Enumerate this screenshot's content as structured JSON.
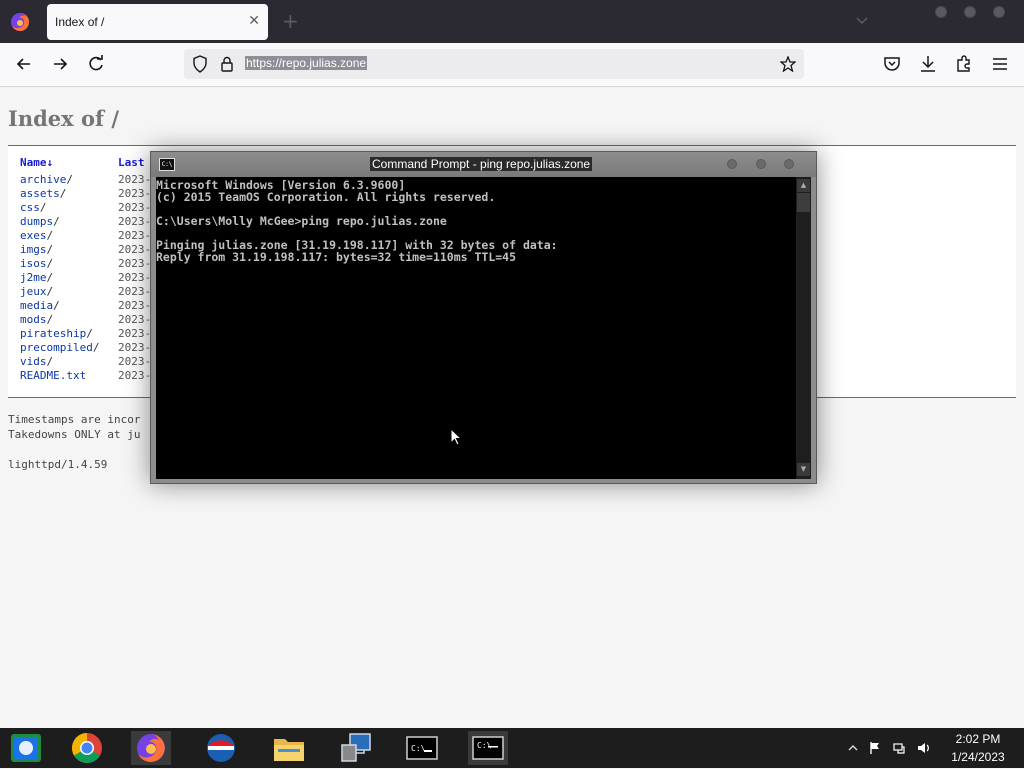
{
  "browser": {
    "tab_title": "Index of /",
    "url": "https://repo.julias.zone"
  },
  "page": {
    "heading": "Index of /",
    "columns": [
      "Name↓",
      "Last"
    ],
    "entries": [
      {
        "name": "archive",
        "suffix": "/",
        "date": "2023-"
      },
      {
        "name": "assets",
        "suffix": "/",
        "date": "2023-"
      },
      {
        "name": "css",
        "suffix": "/",
        "date": "2023-"
      },
      {
        "name": "dumps",
        "suffix": "/",
        "date": "2023-"
      },
      {
        "name": "exes",
        "suffix": "/",
        "date": "2023-"
      },
      {
        "name": "imgs",
        "suffix": "/",
        "date": "2023-"
      },
      {
        "name": "isos",
        "suffix": "/",
        "date": "2023-"
      },
      {
        "name": "j2me",
        "suffix": "/",
        "date": "2023-"
      },
      {
        "name": "jeux",
        "suffix": "/",
        "date": "2023-"
      },
      {
        "name": "media",
        "suffix": "/",
        "date": "2023-"
      },
      {
        "name": "mods",
        "suffix": "/",
        "date": "2023-"
      },
      {
        "name": "pirateship",
        "suffix": "/",
        "date": "2023-"
      },
      {
        "name": "precompiled",
        "suffix": "/",
        "date": "2023-"
      },
      {
        "name": "vids",
        "suffix": "/",
        "date": "2023-"
      },
      {
        "name": "README.txt",
        "suffix": "",
        "date": "2023-"
      }
    ],
    "footer_lines": [
      "Timestamps are incor",
      "Takedowns ONLY at ju"
    ],
    "server_signature": "lighttpd/1.4.59"
  },
  "console": {
    "title": "Command Prompt - ping  repo.julias.zone",
    "lines": [
      "Microsoft Windows [Version 6.3.9600]",
      "(c) 2015 TeamOS Corporation. All rights reserved.",
      "",
      "C:\\Users\\Molly McGee>ping repo.julias.zone",
      "",
      "Pinging julias.zone [31.19.198.117] with 32 bytes of data:",
      "Reply from 31.19.198.117: bytes=32 time=110ms TTL=45"
    ]
  },
  "taskbar": {
    "apps": [
      "intel-graphics-icon",
      "chrome-icon",
      "firefox-icon",
      "opera-icon",
      "file-explorer-icon",
      "network-setup-icon",
      "cmd-icon",
      "cmd-active-icon"
    ],
    "time": "2:02 PM",
    "date": "1/24/2023"
  },
  "colors": {
    "link_blue": "#0b36a8",
    "console_bg": "#000000",
    "console_text": "#c0c0c0",
    "taskbar_bg": "#1d1d1d",
    "tabstrip_bg": "#2b2a33"
  }
}
